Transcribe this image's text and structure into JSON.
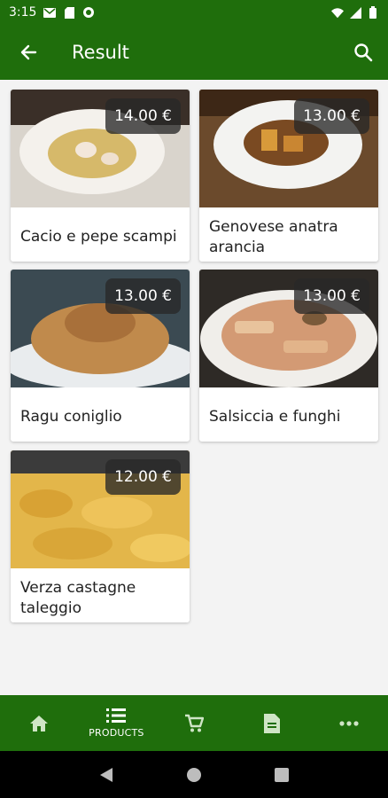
{
  "status_bar": {
    "time": "3:15",
    "icons": [
      "gmail-icon",
      "sim-icon",
      "sync-icon",
      "wifi-icon",
      "signal-icon",
      "battery-icon"
    ]
  },
  "app_bar": {
    "title": "Result",
    "back_icon": "arrow-left-icon",
    "search_icon": "search-icon"
  },
  "products": [
    {
      "name": "Cacio e pepe scampi",
      "price": "14.00 €"
    },
    {
      "name": "Genovese anatra arancia",
      "price": "13.00 €"
    },
    {
      "name": "Ragu coniglio",
      "price": "13.00 €"
    },
    {
      "name": "Salsiccia e funghi",
      "price": "13.00 €"
    },
    {
      "name": "Verza castagne taleggio",
      "price": "12.00 €"
    }
  ],
  "bottom_nav": {
    "items": [
      {
        "icon": "home-icon",
        "label": ""
      },
      {
        "icon": "list-icon",
        "label": "PRODUCTS"
      },
      {
        "icon": "cart-icon",
        "label": ""
      },
      {
        "icon": "document-icon",
        "label": ""
      },
      {
        "icon": "more-icon",
        "label": ""
      }
    ]
  },
  "colors": {
    "primary": "#1f6e0c",
    "background": "#f3f3f3"
  }
}
